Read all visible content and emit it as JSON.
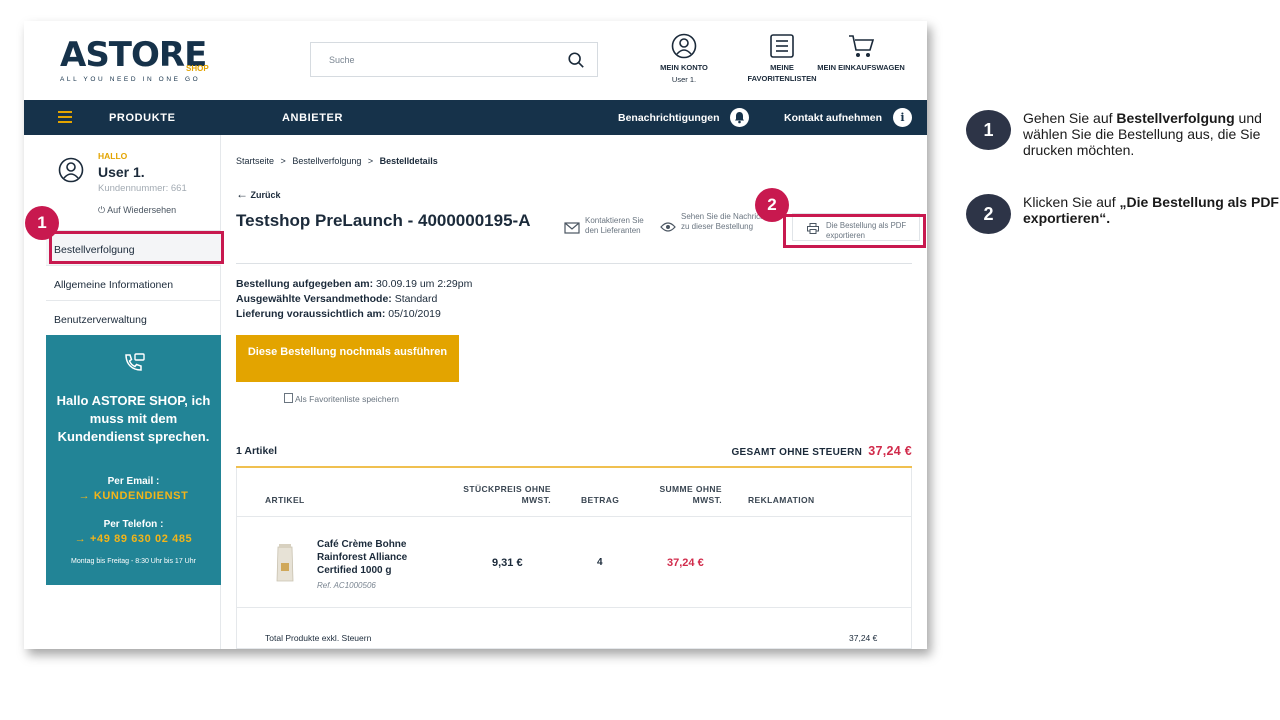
{
  "header": {
    "logo_text": "ASTORE",
    "logo_shop": "SHOP",
    "logo_tagline": "ALL YOU NEED IN ONE GO",
    "search_placeholder": "Suche",
    "account_label": "MEIN KONTO",
    "account_user": "User 1.",
    "favorites_line1": "MEINE",
    "favorites_line2": "FAVORITENLISTEN",
    "cart_label": "MEIN EINKAUFSWAGEN"
  },
  "nav": {
    "produkte": "PRODUKTE",
    "anbieter": "ANBIETER",
    "notifications": "Benachrichtigungen",
    "contact": "Kontakt aufnehmen",
    "contact_badge": "i"
  },
  "sidebar": {
    "hallo": "HALLO",
    "user_name": "User 1.",
    "customer_number": "Kundennummer: 661",
    "logout": "Auf Wiedersehen",
    "items": [
      {
        "label": "Bestellverfolgung"
      },
      {
        "label": "Allgemeine Informationen"
      },
      {
        "label": "Benutzerverwaltung"
      }
    ],
    "support": {
      "text": "Hallo ASTORE SHOP, ich muss mit dem Kundendienst sprechen.",
      "email_label": "Per Email :",
      "email_value": "KUNDENDIENST",
      "phone_label": "Per Telefon :",
      "phone_value": "+49 89 630 02 485",
      "hours": "Montag bis Freitag - 8:30 Uhr bis 17 Uhr",
      "arrow": "→"
    }
  },
  "main": {
    "breadcrumb": {
      "home": "Startseite",
      "sep": ">",
      "tracking": "Bestellverfolgung",
      "current": "Bestelldetails"
    },
    "back": "Zurück",
    "back_arrow": "←",
    "order_title": "Testshop PreLaunch - 4000000195-A",
    "actions": {
      "contact_supplier": "Kontaktieren Sie den Lieferanten",
      "messages": "Sehen Sie die Nachrichten zu dieser Bestellung",
      "export_pdf": "Die Bestellung als PDF exportieren"
    },
    "info": [
      {
        "label": "Bestellung aufgegeben am:",
        "value": "30.09.19 um 2:29pm"
      },
      {
        "label": "Ausgewählte Versandmethode:",
        "value": "Standard"
      },
      {
        "label": "Lieferung voraussichtlich am:",
        "value": "05/10/2019"
      }
    ],
    "reorder_button": "Diese Bestellung nochmals ausführen",
    "save_favorites": "Als Favoritenliste speichern",
    "article_count": "1 Artikel",
    "total_label": "GESAMT OHNE STEUERN",
    "total_amount": "37,24 €",
    "table": {
      "headers": {
        "artikel": "ARTIKEL",
        "unit_price": "STÜCKPREIS OHNE MWST.",
        "quantity": "BETRAG",
        "sum": "SUMME OHNE MWST.",
        "claim": "REKLAMATION"
      },
      "rows": [
        {
          "name": "Café Crème Bohne Rainforest Alliance Certified 1000 g",
          "ref": "Ref. AC1000506",
          "unit_price": "9,31 €",
          "quantity": "4",
          "sum": "37,24 €"
        }
      ],
      "total_products_label": "Total Produkte exkl. Steuern",
      "total_products_value": "37,24 €"
    }
  },
  "annotations": {
    "badge1": "1",
    "badge2": "2"
  },
  "instructions": [
    {
      "num": "1",
      "pre": "Gehen Sie auf ",
      "bold": "Bestellverfolgung",
      "post": " und wählen Sie die Bestellung aus, die Sie drucken möchten."
    },
    {
      "num": "2",
      "pre": "Klicken Sie auf ",
      "bold": "„Die Bestellung als PDF exportieren“.",
      "post": ""
    }
  ],
  "colors": {
    "navy": "#16324a",
    "accent_yellow": "#e3a400",
    "teal": "#228496",
    "price_red": "#d12b4b",
    "annotation_red": "#c8194f"
  }
}
